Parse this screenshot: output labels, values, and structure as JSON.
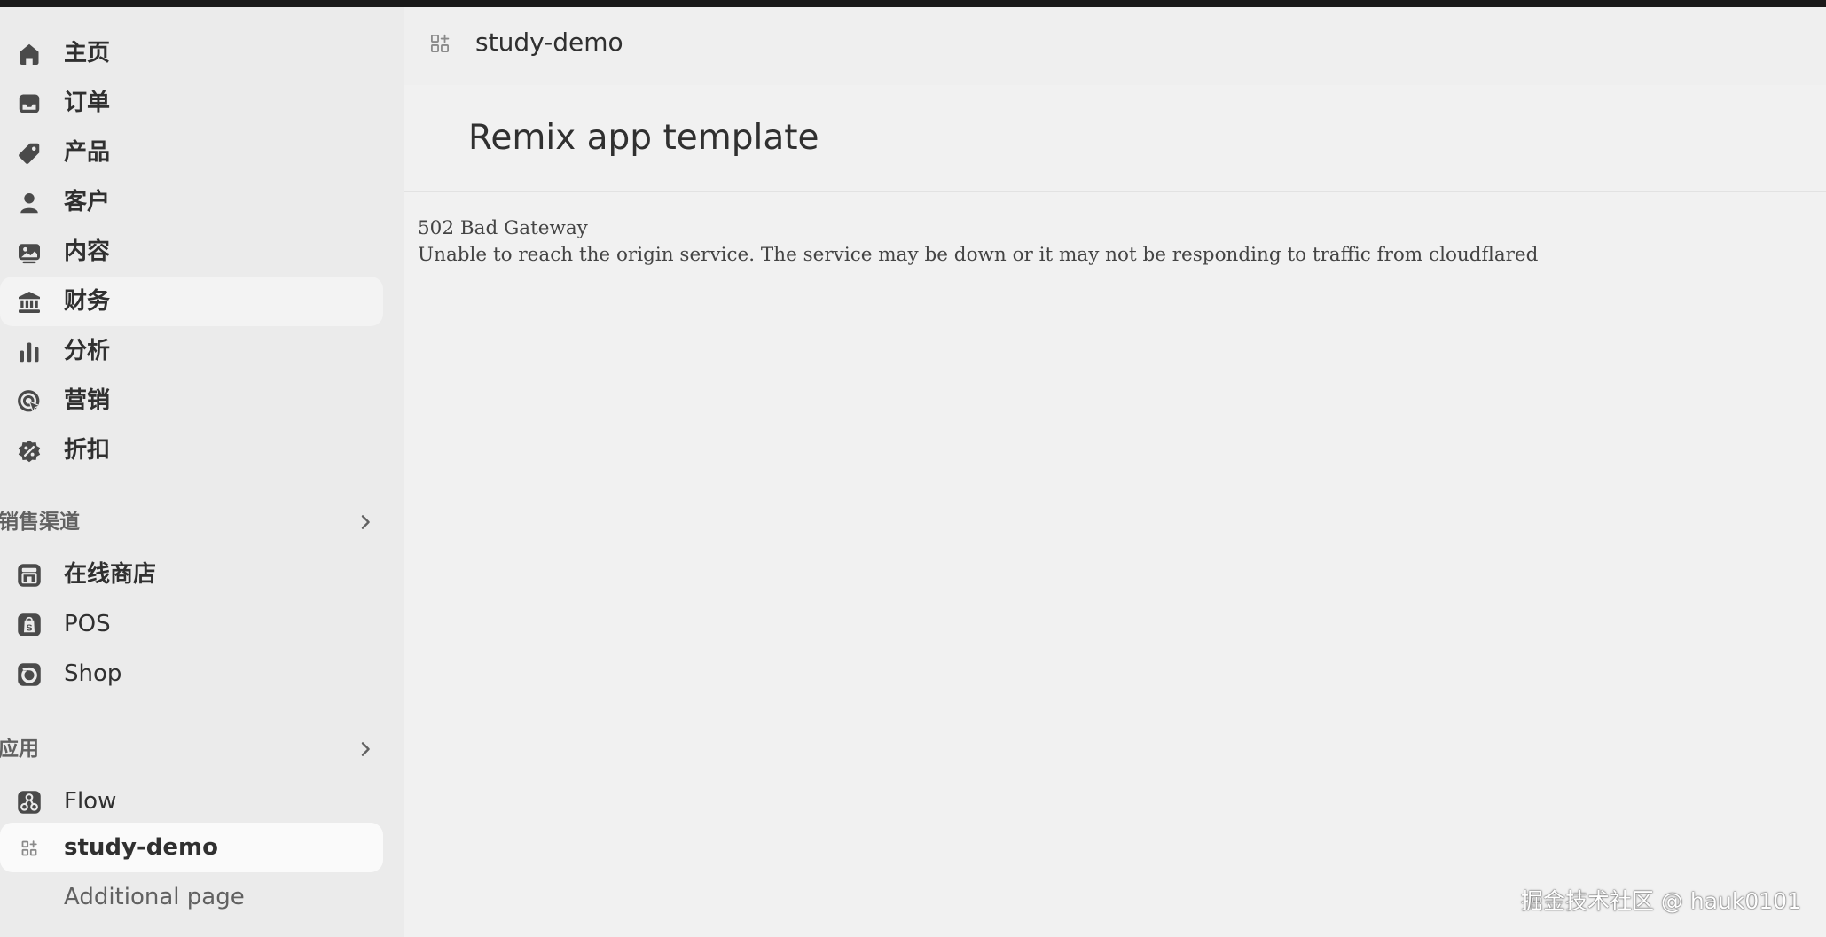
{
  "sidebar": {
    "items": [
      {
        "label": "主页",
        "icon": "home-icon"
      },
      {
        "label": "订单",
        "icon": "inbox-icon"
      },
      {
        "label": "产品",
        "icon": "tag-icon"
      },
      {
        "label": "客户",
        "icon": "person-icon"
      },
      {
        "label": "内容",
        "icon": "image-icon"
      },
      {
        "label": "财务",
        "icon": "bank-icon"
      },
      {
        "label": "分析",
        "icon": "bar-chart-icon"
      },
      {
        "label": "营销",
        "icon": "target-icon"
      },
      {
        "label": "折扣",
        "icon": "discount-icon"
      }
    ],
    "sales_channels": {
      "title": "销售渠道",
      "items": [
        {
          "label": "在线商店",
          "icon": "storefront-icon"
        },
        {
          "label": "POS",
          "icon": "pos-icon"
        },
        {
          "label": "Shop",
          "icon": "shop-app-icon"
        }
      ]
    },
    "apps": {
      "title": "应用",
      "items": [
        {
          "label": "Flow",
          "icon": "flow-icon"
        },
        {
          "label": "study-demo",
          "icon": "apps-icon"
        },
        {
          "label": "Additional page"
        }
      ]
    }
  },
  "header": {
    "app_name": "study-demo"
  },
  "main": {
    "page_title": "Remix app template",
    "error_title": "502 Bad Gateway",
    "error_message": "Unable to reach the origin service. The service may be down or it may not be responding to traffic from cloudflared"
  },
  "watermark": "掘金技术社区 @ hauk0101"
}
